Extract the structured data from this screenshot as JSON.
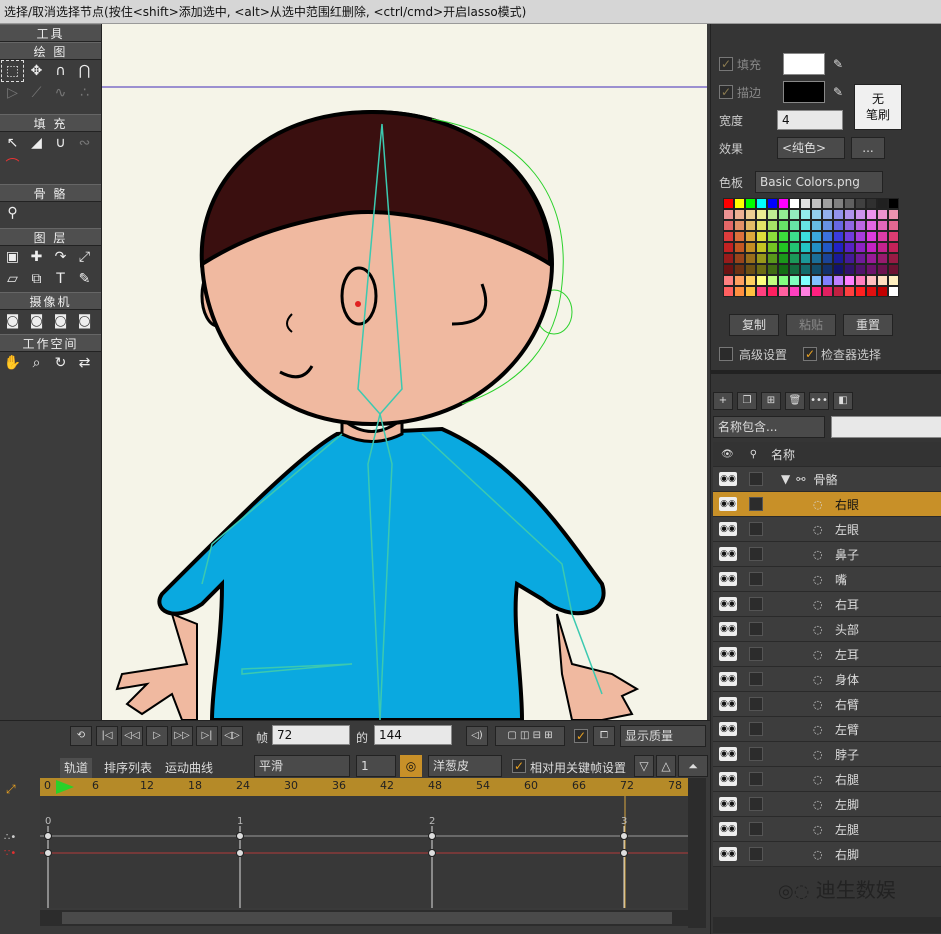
{
  "status_text": "选择/取消选择节点(按住<shift>添加选中, <alt>从选中范围红删除, <ctrl/cmd>开启lasso模式)",
  "tools": {
    "title": "工具",
    "sections": [
      {
        "label": "绘 图"
      },
      {
        "label": "填 充"
      },
      {
        "label": "骨 骼"
      },
      {
        "label": "图 层"
      },
      {
        "label": "摄像机"
      },
      {
        "label": "工作空间"
      }
    ]
  },
  "style_panel": {
    "fill_label": "填充",
    "stroke_label": "描边",
    "no_brush_label": "无\n笔刷",
    "width_label": "宽度",
    "width_value": "4",
    "effect_label": "效果",
    "effect_value": "<纯色>",
    "effect_more": "...",
    "palette_label": "色板",
    "palette_value": "Basic Colors.png",
    "copy_label": "复制",
    "paste_label": "粘贴",
    "reset_label": "重置",
    "advanced_label": "高级设置",
    "inspector_label": "检查器选择",
    "fill_color": "#ffffff",
    "stroke_color": "#000000"
  },
  "layers_panel": {
    "filter_value": "名称包含...",
    "name_header": "名称",
    "group_name": "骨骼",
    "layers": [
      {
        "name": "右眼"
      },
      {
        "name": "左眼"
      },
      {
        "name": "鼻子"
      },
      {
        "name": "嘴"
      },
      {
        "name": "右耳"
      },
      {
        "name": "头部"
      },
      {
        "name": "左耳"
      },
      {
        "name": "身体"
      },
      {
        "name": "右臂"
      },
      {
        "name": "左臂"
      },
      {
        "name": "脖子"
      },
      {
        "name": "右腿"
      },
      {
        "name": "左脚"
      },
      {
        "name": "左腿"
      },
      {
        "name": "右脚"
      }
    ]
  },
  "transport": {
    "frame_label": "帧",
    "frame_value": "72",
    "of_label": "的",
    "total_value": "144",
    "quality_label": "显示质量"
  },
  "timeline": {
    "tabs": [
      {
        "label": "轨道"
      },
      {
        "label": "排序列表"
      },
      {
        "label": "运动曲线"
      }
    ],
    "interp_value": "平滑",
    "interval_value": "1",
    "onion_label": "洋葱皮",
    "relative_label": "相对用关键帧设置",
    "ruler_labels": [
      "0",
      "6",
      "12",
      "18",
      "24",
      "30",
      "36",
      "42",
      "48",
      "54",
      "60",
      "66",
      "72",
      "78"
    ],
    "key_labels": [
      "0",
      "1",
      "2",
      "3"
    ]
  },
  "watermark": "迪生数娱",
  "accent_color": "#c89028"
}
